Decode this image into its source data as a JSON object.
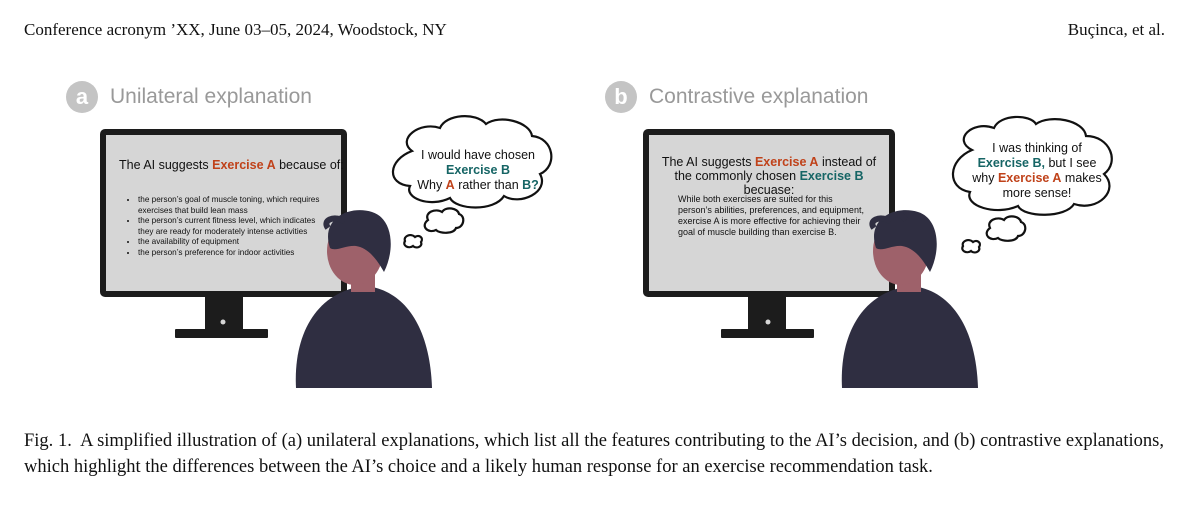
{
  "header": {
    "left": "Conference acronym ’XX, June 03–05, 2024, Woodstock, NY",
    "right": "Buçinca, et al."
  },
  "panel_a": {
    "badge": "a",
    "title": "Unilateral explanation",
    "screen_intro": "The AI suggests",
    "screen_choice": "Exercise A",
    "screen_because": "because of:",
    "reasons": [
      "the person’s goal of muscle toning, which requires exercises that build lean mass",
      "the person’s current fitness level, which indicates they are ready for moderately intense activities",
      "the availability of equipment",
      "the person’s preference for indoor activities"
    ],
    "bubble_line1": "I would have chosen",
    "bubble_choice": "Exercise B",
    "bubble_why": "Why",
    "bubble_a": "A",
    "bubble_rather": "rather than",
    "bubble_b": "B?"
  },
  "panel_b": {
    "badge": "b",
    "title": "Contrastive explanation",
    "screen_intro": "The AI suggests",
    "screen_choice": "Exercise A",
    "screen_instead": "instead of",
    "screen_common": "the commonly chosen",
    "screen_alt": "Exercise B",
    "screen_because": "becuase:",
    "screen_body": "While both exercises are suited for this person’s abilities, preferences, and equipment, exercise A is more effective for achieving their goal of muscle building than exercise B.",
    "bubble_line1": "I was thinking of",
    "bubble_alt": "Exercise B,",
    "bubble_but": "but I see",
    "bubble_why": "why",
    "bubble_choice": "Exercise A",
    "bubble_makes": "makes",
    "bubble_end": "more sense!"
  },
  "caption": {
    "label": "Fig. 1.",
    "text": "A simplified illustration of (a) unilateral explanations, which list all the features contributing to the AI’s decision, and (b) contrastive explanations, which highlight the differences between the AI’s choice and a likely human response for an exercise recommendation task."
  },
  "colors": {
    "choice_red": "#c0421a",
    "alt_teal": "#166565",
    "person": "#2f2e41",
    "skin": "#9e616a",
    "screen": "#d6d6d6"
  }
}
